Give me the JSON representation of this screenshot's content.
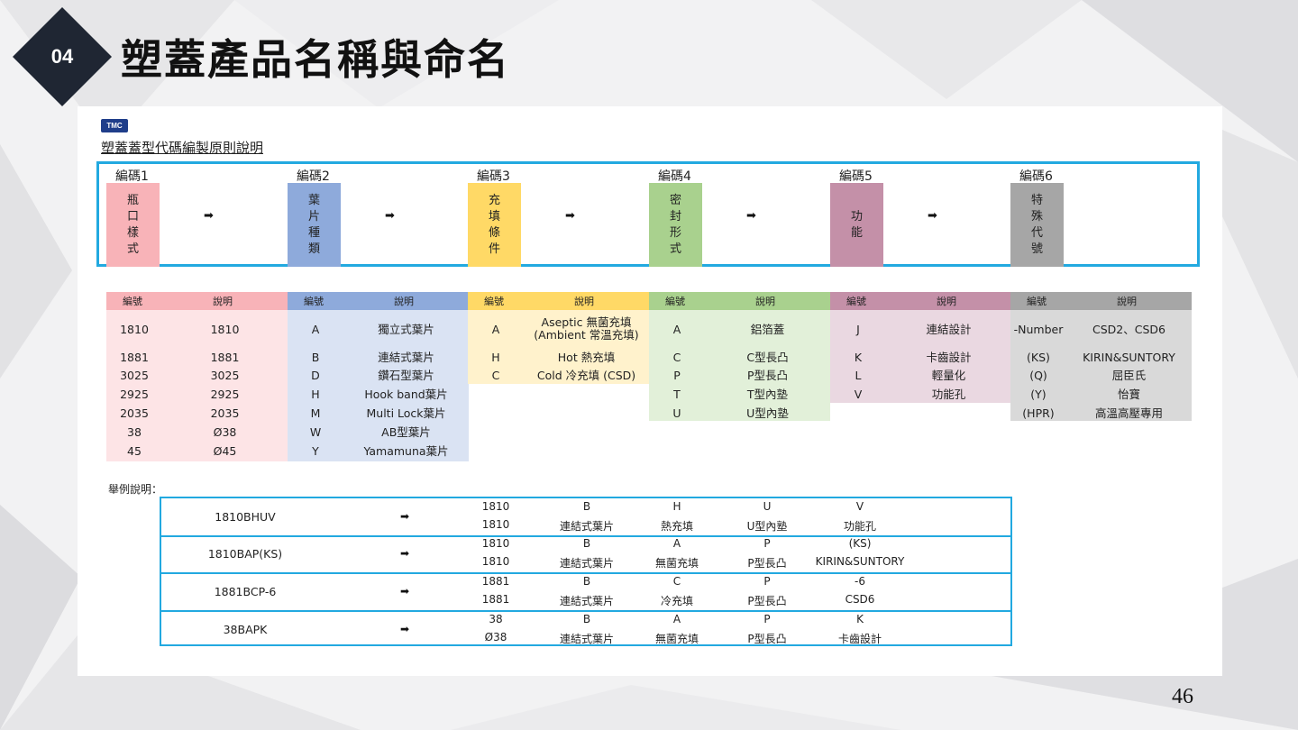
{
  "header": {
    "badge_number": "04",
    "title": "塑蓋產品名稱與命名"
  },
  "logo_text": "TMC",
  "subtitle": "塑蓋蓋型代碼編製原則說明",
  "colors": {
    "accent_frame": "#22a9e0",
    "badge": "#1f2633",
    "code1": "#f8b3b8",
    "code2": "#8eaadb",
    "code3": "#ffd966",
    "code4": "#a9d18e",
    "code5": "#c490a8",
    "code6": "#a6a6a6"
  },
  "arrow_glyph": "➡",
  "codes": [
    {
      "label": "編碼1",
      "chars": [
        "瓶",
        "口",
        "樣",
        "式"
      ]
    },
    {
      "label": "編碼2",
      "chars": [
        "葉",
        "片",
        "種",
        "類"
      ]
    },
    {
      "label": "編碼3",
      "chars": [
        "充",
        "填",
        "條",
        "件"
      ]
    },
    {
      "label": "編碼4",
      "chars": [
        "密",
        "封",
        "形",
        "式"
      ]
    },
    {
      "label": "編碼5",
      "chars": [
        "功",
        "能"
      ]
    },
    {
      "label": "編碼6",
      "chars": [
        "特",
        "殊",
        "代",
        "號"
      ]
    }
  ],
  "tables": [
    {
      "head": [
        "編號",
        "說明"
      ],
      "rows": [
        [
          "1810",
          "1810"
        ],
        [
          "1881",
          "1881"
        ],
        [
          "3025",
          "3025"
        ],
        [
          "2925",
          "2925"
        ],
        [
          "2035",
          "2035"
        ],
        [
          "38",
          "Ø38"
        ],
        [
          "45",
          "Ø45"
        ]
      ]
    },
    {
      "head": [
        "編號",
        "說明"
      ],
      "rows": [
        [
          "A",
          "獨立式葉片"
        ],
        [
          "B",
          "連結式葉片"
        ],
        [
          "D",
          "鑽石型葉片"
        ],
        [
          "H",
          "Hook band葉片"
        ],
        [
          "M",
          "Multi Lock葉片"
        ],
        [
          "W",
          "AB型葉片"
        ],
        [
          "Y",
          "Yamamuna葉片"
        ]
      ]
    },
    {
      "head": [
        "編號",
        "說明"
      ],
      "rows": [
        [
          "A",
          "Aseptic 無菌充填\n(Ambient 常溫充填)"
        ],
        [
          "H",
          "Hot 熱充填"
        ],
        [
          "C",
          "Cold 冷充填 (CSD)"
        ]
      ]
    },
    {
      "head": [
        "編號",
        "說明"
      ],
      "rows": [
        [
          "A",
          "鋁箔蓋"
        ],
        [
          "C",
          "C型長凸"
        ],
        [
          "P",
          "P型長凸"
        ],
        [
          "T",
          "T型內塾"
        ],
        [
          "U",
          "U型內塾"
        ]
      ]
    },
    {
      "head": [
        "編號",
        "說明"
      ],
      "rows": [
        [
          "J",
          "連結設計"
        ],
        [
          "K",
          "卡齒設計"
        ],
        [
          "L",
          "輕量化"
        ],
        [
          "V",
          "功能孔"
        ]
      ]
    },
    {
      "head": [
        "編號",
        "說明"
      ],
      "rows": [
        [
          "-Number",
          "CSD2、CSD6"
        ],
        [
          "(KS)",
          "KIRIN&SUNTORY"
        ],
        [
          "(Q)",
          "屈臣氏"
        ],
        [
          "(Y)",
          "怡寶"
        ],
        [
          "(HPR)",
          "高溫高壓專用"
        ]
      ]
    }
  ],
  "example_label": "舉例說明：",
  "examples": [
    {
      "code": "1810BHUV",
      "top": [
        "1810",
        "B",
        "H",
        "U",
        "V"
      ],
      "bottom": [
        "1810",
        "連結式葉片",
        "熱充填",
        "U型內塾",
        "功能孔"
      ]
    },
    {
      "code": "1810BAP(KS)",
      "top": [
        "1810",
        "B",
        "A",
        "P",
        "(KS)"
      ],
      "bottom": [
        "1810",
        "連結式葉片",
        "無菌充填",
        "P型長凸",
        "KIRIN&SUNTORY"
      ]
    },
    {
      "code": "1881BCP-6",
      "top": [
        "1881",
        "B",
        "C",
        "P",
        "-6"
      ],
      "bottom": [
        "1881",
        "連結式葉片",
        "冷充填",
        "P型長凸",
        "CSD6"
      ]
    },
    {
      "code": "38BAPK",
      "top": [
        "38",
        "B",
        "A",
        "P",
        "K"
      ],
      "bottom": [
        "Ø38",
        "連結式葉片",
        "無菌充填",
        "P型長凸",
        "卡齒設計"
      ]
    }
  ],
  "page_number": "46"
}
